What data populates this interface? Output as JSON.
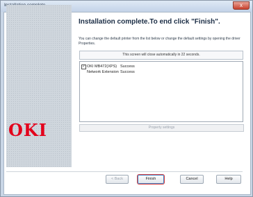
{
  "window": {
    "title": "Installation complete",
    "close_glyph": "x"
  },
  "sidebar": {
    "logo_text": "OKI"
  },
  "main": {
    "heading": "Installation complete.To end click \"Finish\".",
    "description": "You can change the default printer from the list below or change the default settings by opening the driver Properties.",
    "notice": "This screen will close automatically in 22 seconds.",
    "results": [
      {
        "name": "OKI MB472(XPS)",
        "status": "Success",
        "checked": true
      },
      {
        "name": "Network Extension",
        "status": "Success",
        "checked": false
      }
    ],
    "check_glyph": "✓",
    "property_button": "Property settings"
  },
  "footer": {
    "back": "< Back",
    "finish": "Finish",
    "cancel": "Cancel",
    "help": "Help"
  }
}
